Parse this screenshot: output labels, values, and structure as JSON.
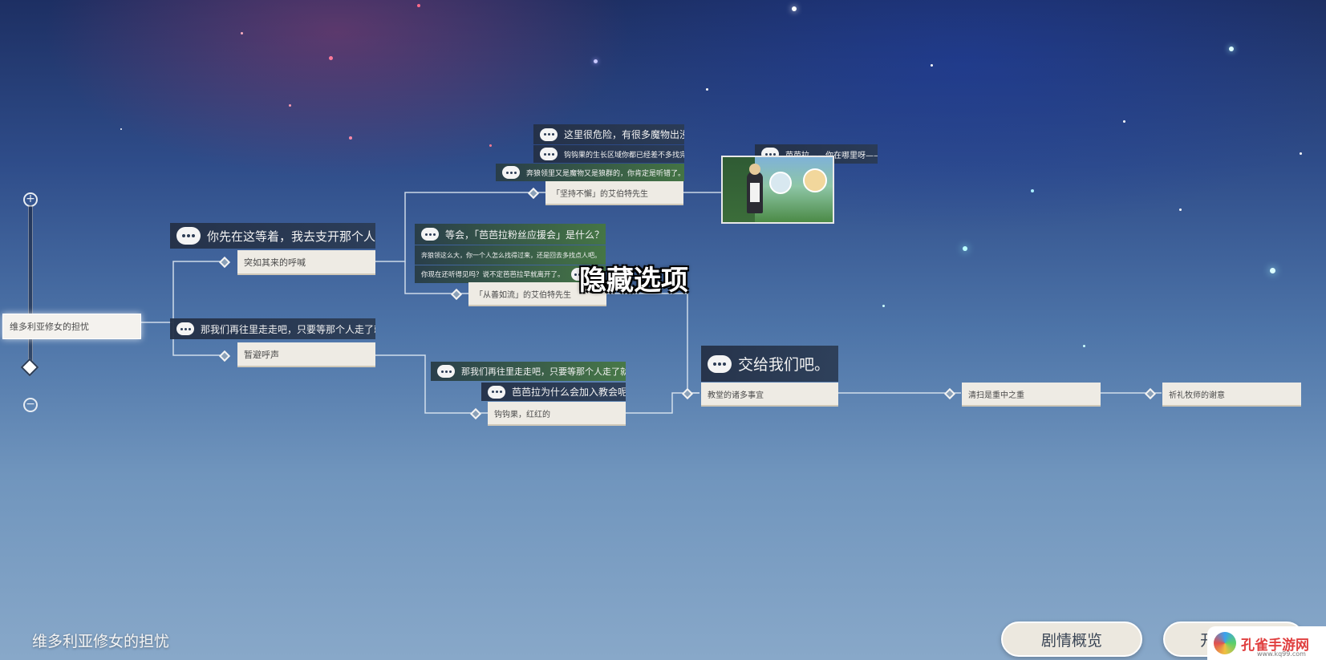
{
  "quest": {
    "title": "维多利亚修女的担忧"
  },
  "annotation": {
    "hidden_option": "隐藏选项"
  },
  "buttons": {
    "overview": "剧情概览",
    "start_partial": "开"
  },
  "watermark": {
    "name": "孔雀手游网",
    "url": "www.kq99.com"
  },
  "zoom": {
    "in_symbol": "+",
    "out_symbol": "−"
  },
  "root_node": {
    "label": "维多利亚修女的担忧"
  },
  "upper_branch": {
    "dialog": "你先在这等着，我去支开那个人。",
    "node": "突如其来的呼喊"
  },
  "lower_branch": {
    "dialog": "那我们再往里走走吧，只要等那个人走了就好。",
    "node": "暂避呼声"
  },
  "branch_a": {
    "dialog_1": "这里很危险，有很多魔物出没。",
    "dialog_2": "钩钩果的生长区域你都已经差不多找完了。",
    "dialog_3": "奔狼领里又是魔物又是狼群的，你肯定是听错了。",
    "node": "「坚持不懈」的艾伯特先生"
  },
  "branch_b": {
    "dialog_1": "等会，「芭芭拉粉丝应援会」是什么？",
    "dialog_2": "奔狼领这么大，你一个人怎么找得过来，还是回去多找点人吧。",
    "dialog_3": "你现在还听得见吗？说不定芭芭拉早就离开了。",
    "node": "「从善如流」的艾伯特先生"
  },
  "branch_c": {
    "dialog_1": "那我们再往里走走吧，只要等那个人走了就好。",
    "dialog_2": "芭芭拉为什么会加入教会呢？",
    "node": "钩钩果，红红的"
  },
  "ending_card": {
    "title": "芭芭拉——你在哪里呀——"
  },
  "merge": {
    "dialog": "交给我们吧。",
    "node_1": "教堂的诸多事宜",
    "node_2": "清扫是重中之重",
    "node_3": "祈礼牧师的谢意"
  }
}
